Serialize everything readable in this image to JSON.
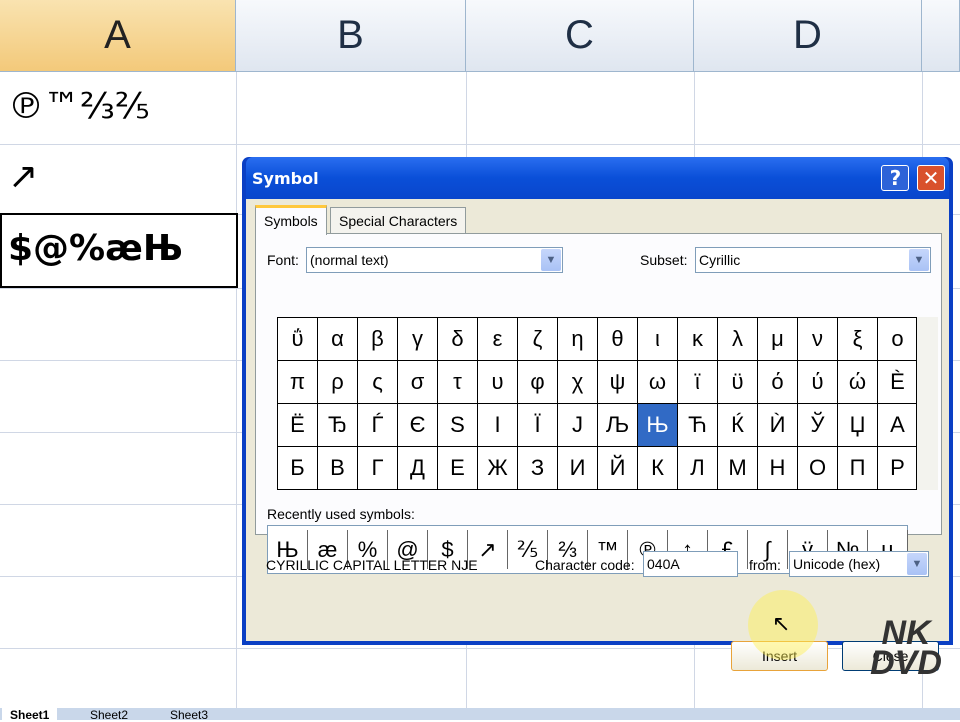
{
  "columns": [
    "A",
    "B",
    "C",
    "D"
  ],
  "cells": {
    "a1": "℗™⅔⅖",
    "a2": "↗",
    "a3": "$@%æЊ"
  },
  "dialog": {
    "title": "Symbol",
    "help": "?",
    "close": "✕",
    "tabs": [
      "Symbols",
      "Special Characters"
    ],
    "font_label": "Font:",
    "font_value": "(normal text)",
    "subset_label": "Subset:",
    "subset_value": "Cyrillic",
    "symbols": [
      "ΰ",
      "α",
      "β",
      "γ",
      "δ",
      "ε",
      "ζ",
      "η",
      "θ",
      "ι",
      "κ",
      "λ",
      "μ",
      "ν",
      "ξ",
      "ο",
      "π",
      "ρ",
      "ς",
      "σ",
      "τ",
      "υ",
      "φ",
      "χ",
      "ψ",
      "ω",
      "ϊ",
      "ϋ",
      "ό",
      "ύ",
      "ώ",
      "Ѐ",
      "Ё",
      "Ђ",
      "Ѓ",
      "Є",
      "Ѕ",
      "І",
      "Ї",
      "Ј",
      "Љ",
      "Њ",
      "Ћ",
      "Ќ",
      "Ѝ",
      "Ў",
      "Џ",
      "А",
      "Б",
      "В",
      "Г",
      "Д",
      "Е",
      "Ж",
      "З",
      "И",
      "Й",
      "К",
      "Л",
      "М",
      "Н",
      "О",
      "П",
      "Р"
    ],
    "selected_index": 41,
    "recent_label": "Recently used symbols:",
    "recent": [
      "Њ",
      "æ",
      "%",
      "@",
      "$",
      "↗",
      "⅖",
      "⅔",
      "™",
      "℗",
      "↕",
      "£",
      "∫",
      "ÿ",
      "№",
      "µ"
    ],
    "char_name": "CYRILLIC CAPITAL LETTER NJE",
    "code_label": "Character code:",
    "code_value": "040A",
    "from_label": "from:",
    "from_value": "Unicode (hex)",
    "insert": "Insert",
    "close_btn": "Close"
  },
  "watermark": "NK DVD",
  "sheets": [
    "Sheet1",
    "Sheet2",
    "Sheet3"
  ]
}
